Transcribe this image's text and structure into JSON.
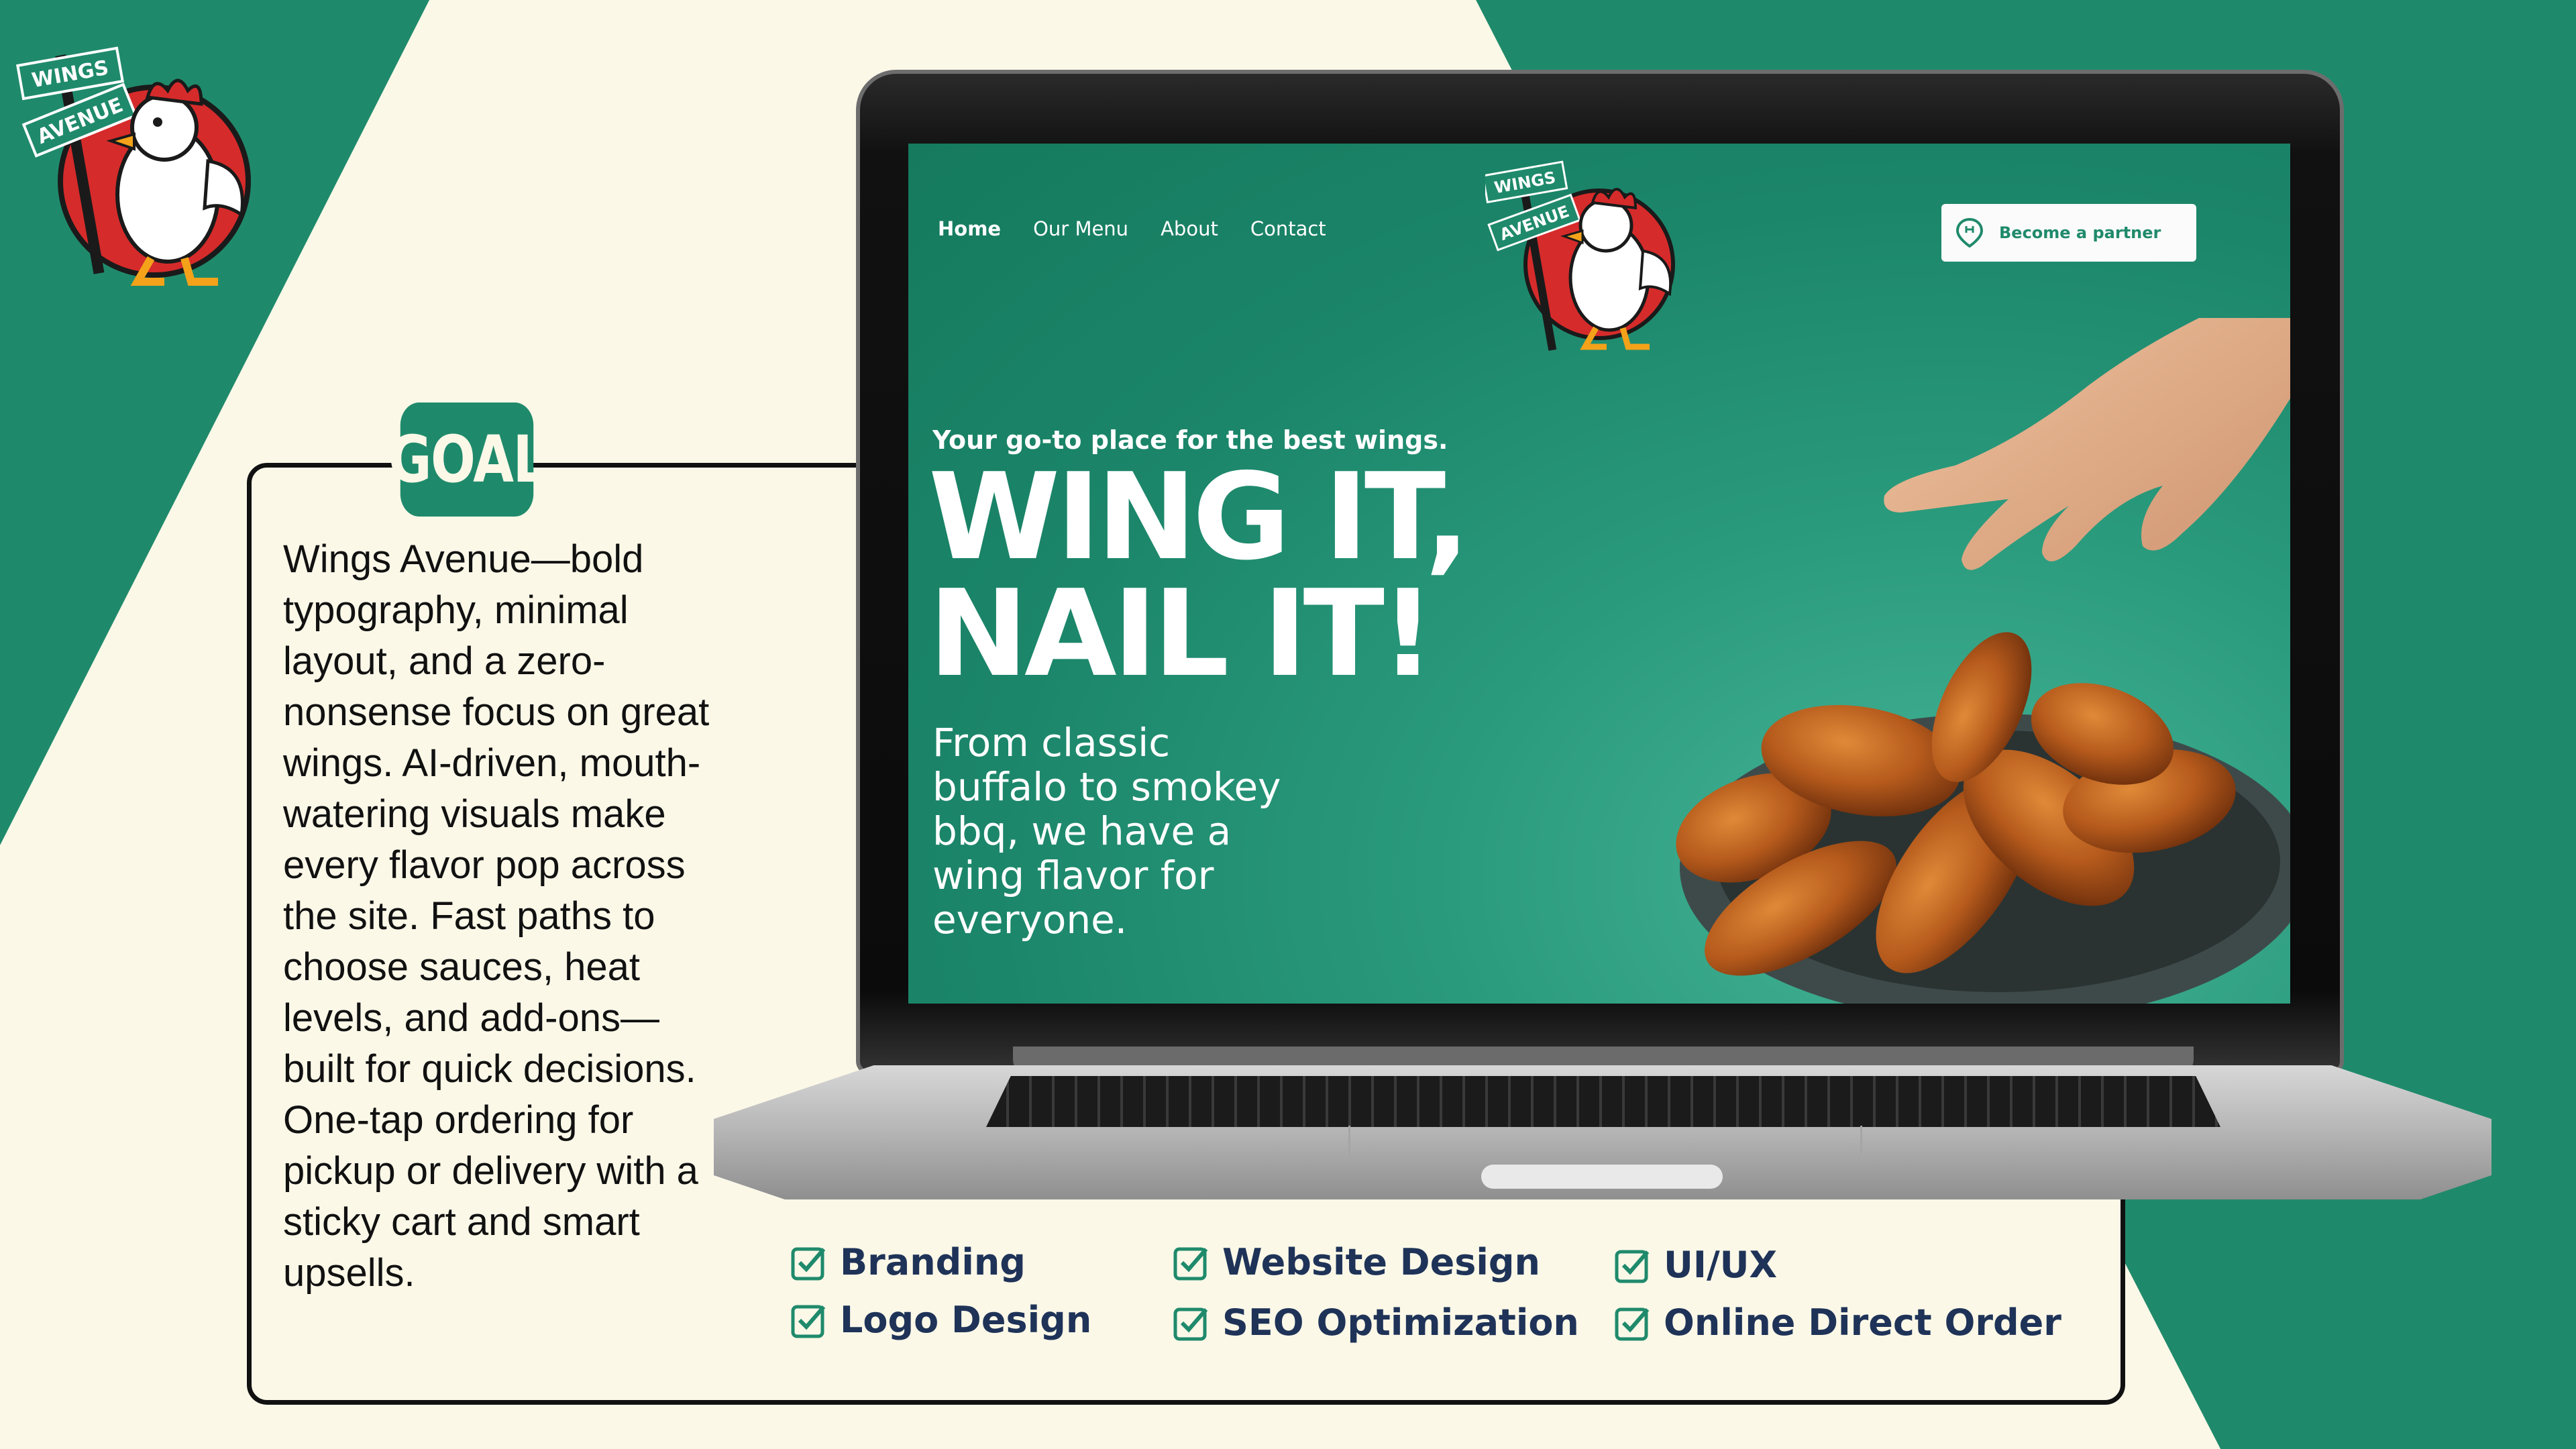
{
  "brand": {
    "logo_sign_top": "WINGS",
    "logo_sign_bottom": "AVENUE"
  },
  "goal": {
    "badge": "GOAL",
    "text": "Wings Avenue—bold typography, minimal layout, and a zero-nonsense focus on great wings. AI-driven, mouth-watering visuals make every flavor pop across the site. Fast paths to choose sauces, heat levels, and add-ons—built for quick decisions. One-tap ordering for pickup or delivery with a sticky cart and smart upsells."
  },
  "site": {
    "nav": [
      "Home",
      "Our Menu",
      "About",
      "Contact"
    ],
    "partner_button": "Become a partner",
    "logo_sign_top": "WINGS",
    "logo_sign_bottom": "AVENUE",
    "tagline": "Your go-to place for the best wings.",
    "hero_line1": "WING IT,",
    "hero_line2": "NAIL IT!",
    "hero_sub": "From classic buffalo to smokey bbq, we have a wing flavor for everyone."
  },
  "services": [
    "Branding",
    "Logo Design",
    "Website Design",
    "SEO Optimization",
    "UI/UX",
    "Online Direct Order"
  ],
  "colors": {
    "brand_green": "#1f8a6b",
    "cream": "#fbf8e8",
    "navy": "#1f3358",
    "logo_red": "#d62b2b"
  },
  "icons": {
    "check": "checkbox-check-icon",
    "partner": "location-pin-icon"
  }
}
